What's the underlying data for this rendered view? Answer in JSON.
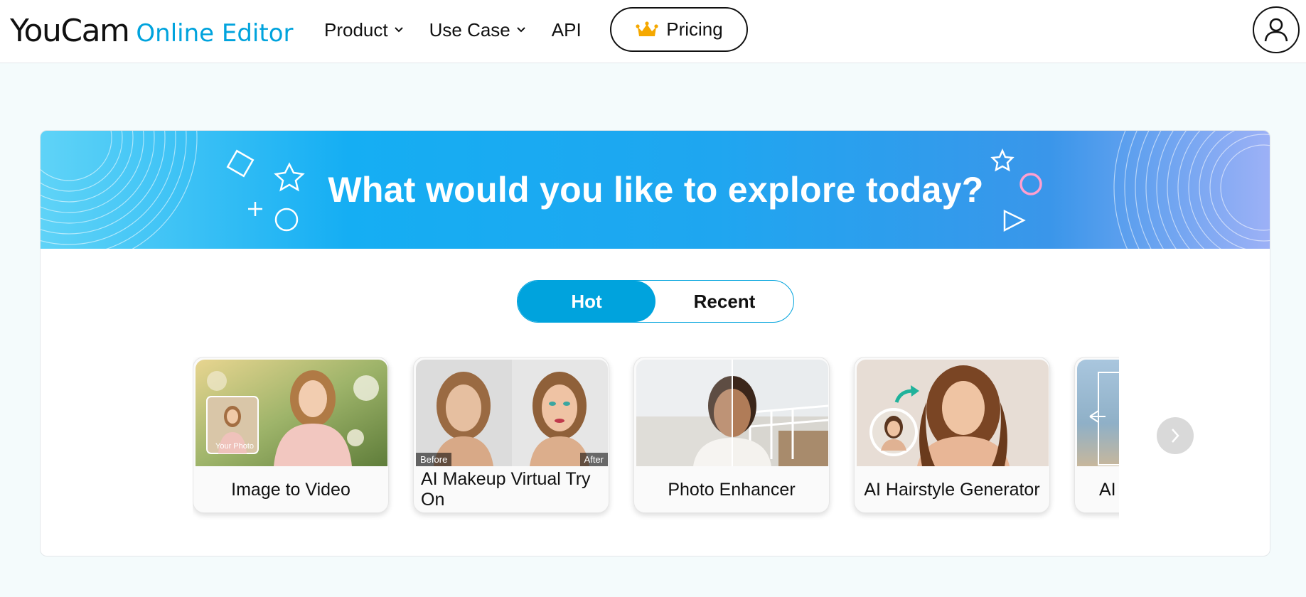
{
  "header": {
    "logo_main": "YouCam",
    "logo_sub": "Online Editor",
    "nav": [
      {
        "label": "Product",
        "has_dropdown": true,
        "icon": "chevron-down-icon"
      },
      {
        "label": "Use Case",
        "has_dropdown": true,
        "icon": "chevron-down-icon"
      },
      {
        "label": "API",
        "has_dropdown": false
      }
    ],
    "pricing_label": "Pricing",
    "pricing_icon": "crown-icon",
    "account_icon": "user-icon"
  },
  "banner": {
    "title": "What would you like to explore today?"
  },
  "tabs": {
    "items": [
      {
        "label": "Hot",
        "active": true
      },
      {
        "label": "Recent",
        "active": false
      }
    ]
  },
  "features": [
    {
      "label": "Image to Video",
      "thumb_tag": "Your Photo"
    },
    {
      "label": "AI Makeup Virtual Try On",
      "before_tag": "Before",
      "after_tag": "After"
    },
    {
      "label": "Photo Enhancer"
    },
    {
      "label": "AI Hairstyle Generator"
    },
    {
      "label": "AI"
    }
  ],
  "carousel": {
    "next_icon": "chevron-right-icon"
  },
  "colors": {
    "brand": "#00a3dd",
    "crown": "#f5a800",
    "banner_start": "#5fd3f7",
    "banner_end": "#9db1f6",
    "page_bg": "#f4fbfc"
  }
}
